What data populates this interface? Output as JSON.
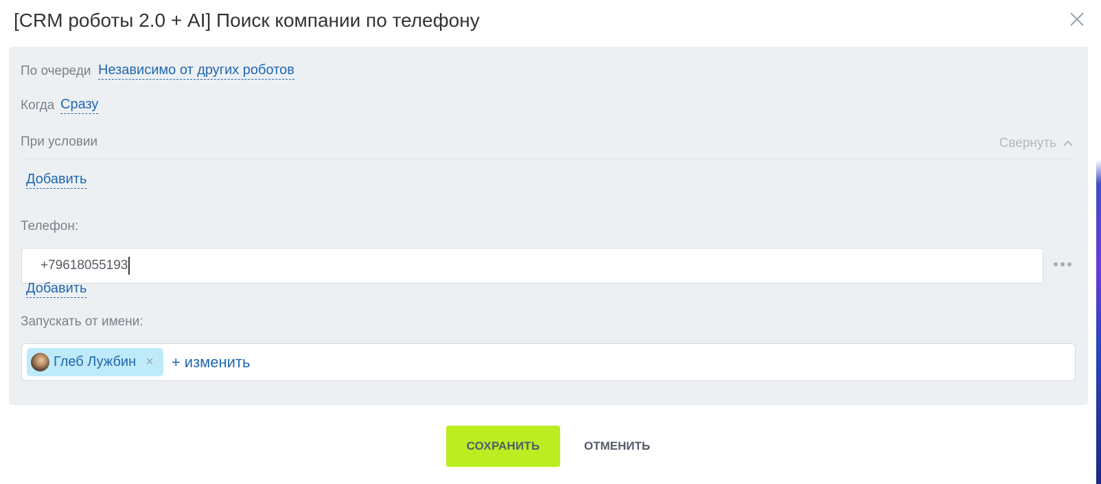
{
  "dialog": {
    "title": "[CRM роботы 2.0 + AI] Поиск компании по телефону",
    "close_icon": "close-icon"
  },
  "settings": {
    "queue_label": "По очереди",
    "queue_value": "Независимо от других роботов",
    "when_label": "Когда",
    "when_value": "Сразу",
    "condition_label": "При условии",
    "collapse_label": "Свернуть",
    "collapse_icon": "chevron-up-icon",
    "condition_add_label": "Добавить"
  },
  "phone": {
    "label": "Телефон:",
    "value": "+79618055193",
    "add_label": "Добавить",
    "more_icon": "more-dots-icon"
  },
  "run_as": {
    "label": "Запускать от имени:",
    "user_name": "Глеб Лужбин",
    "remove_icon": "×",
    "change_label": "+ изменить"
  },
  "footer": {
    "save_label": "СОХРАНИТЬ",
    "cancel_label": "ОТМЕНИТЬ"
  },
  "colors": {
    "accent_link": "#2067b0",
    "save_button": "#bbed21",
    "panel_bg": "#edf0f3",
    "user_chip": "#bfeaf9"
  }
}
